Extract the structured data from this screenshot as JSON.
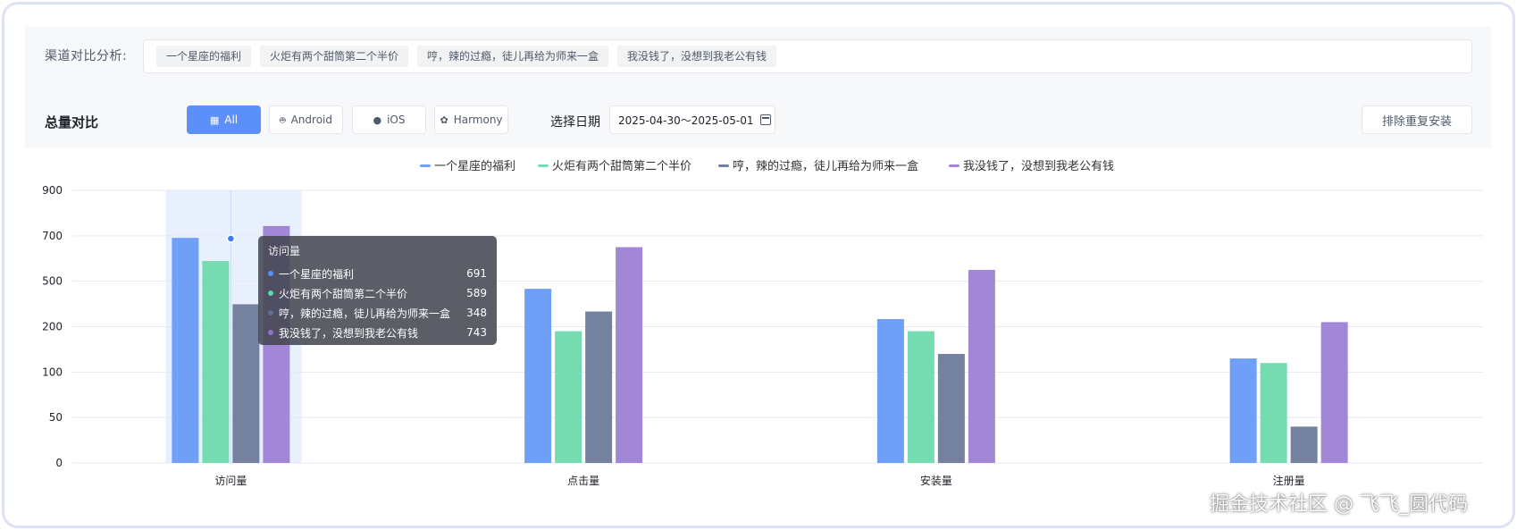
{
  "channel": {
    "label": "渠道对比分析:",
    "tags": [
      "一个星座的福利",
      "火炬有两个甜筒第二个半价",
      "哼，辣的过瘾，徒儿再给为师来一盒",
      "我没钱了，没想到我老公有钱"
    ]
  },
  "filter": {
    "title": "总量对比",
    "platforms": [
      {
        "label": "All",
        "icon": "grid-icon",
        "active": true
      },
      {
        "label": "Android",
        "icon": "android-icon",
        "active": false
      },
      {
        "label": "iOS",
        "icon": "apple-icon",
        "active": false
      },
      {
        "label": "Harmony",
        "icon": "huawei-icon",
        "active": false
      }
    ],
    "date_label": "选择日期",
    "date_range": "2025-04-30～2025-05-01",
    "dedupe_label": "排除重复安装"
  },
  "colors": {
    "series": [
      "#6f9ff7",
      "#74dcb0",
      "#74829f",
      "#a187d6"
    ],
    "highlight": "#e8f0fd",
    "grid": "#e6e9ef",
    "axis_text": "#1f2329"
  },
  "chart_data": {
    "type": "bar",
    "categories": [
      "访问量",
      "点击量",
      "安装量",
      "注册量"
    ],
    "y_ticks": [
      "900",
      "700",
      "500",
      "200",
      "100",
      "50",
      "0"
    ],
    "series": [
      {
        "name": "一个星座的福利",
        "values": [
          691,
          450,
          250,
          130
        ]
      },
      {
        "name": "火炬有两个甜筒第二个半价",
        "values": [
          589,
          190,
          190,
          120
        ]
      },
      {
        "name": "哼，辣的过瘾，徒儿再给为师来一盒",
        "values": [
          348,
          300,
          140,
          40
        ]
      },
      {
        "name": "我没钱了，没想到我老公有钱",
        "values": [
          743,
          650,
          550,
          230
        ]
      }
    ],
    "legend_position": "top",
    "grid": true,
    "highlighted_category": 0
  },
  "tooltip": {
    "title": "访问量",
    "rows": [
      {
        "name": "一个星座的福利",
        "value": "691"
      },
      {
        "name": "火炬有两个甜筒第二个半价",
        "value": "589"
      },
      {
        "name": "哼，辣的过瘾，徒儿再给为师来一盒",
        "value": "348"
      },
      {
        "name": "我没钱了，没想到我老公有钱",
        "value": "743"
      }
    ]
  },
  "watermark": "掘金技术社区 @ 飞飞_圆代码"
}
